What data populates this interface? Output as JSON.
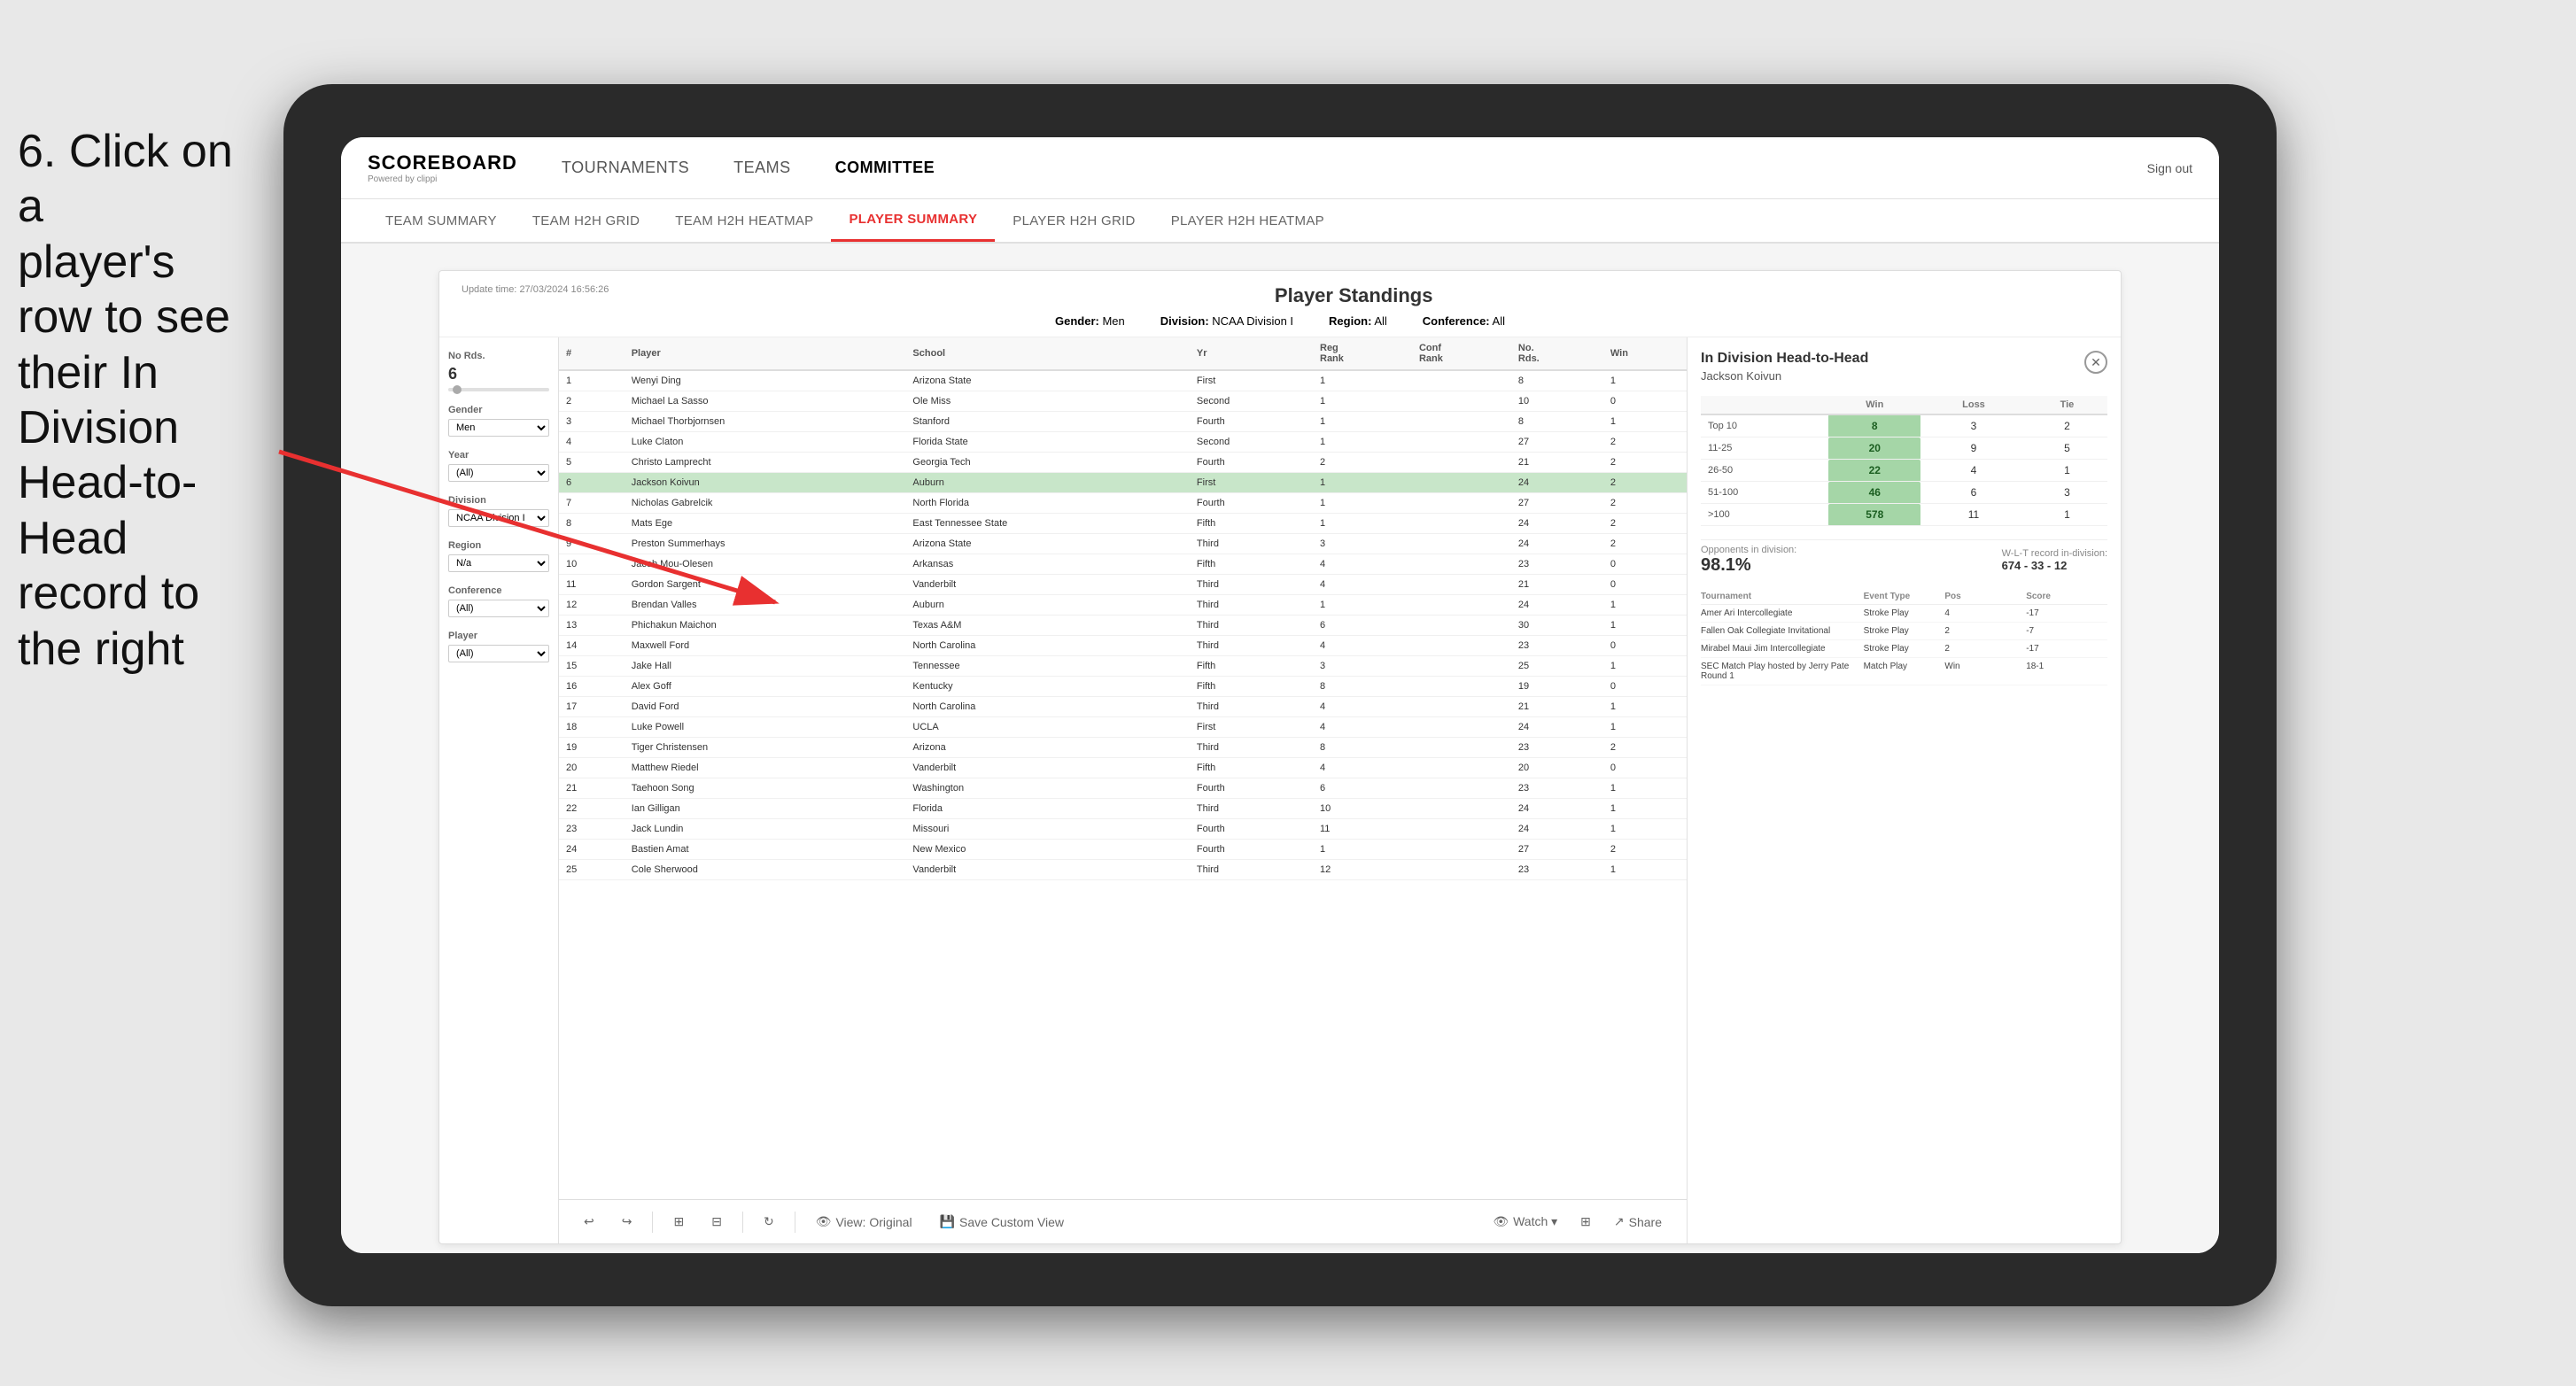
{
  "instruction": {
    "line1": "6. Click on a",
    "line2": "player's row to see",
    "line3": "their In Division",
    "line4": "Head-to-Head",
    "line5": "record to the right"
  },
  "nav": {
    "logo": "SCOREBOARD",
    "logo_sub": "Powered by clippi",
    "items": [
      "TOURNAMENTS",
      "TEAMS",
      "COMMITTEE"
    ],
    "sign_in": "Sign out"
  },
  "sub_nav": {
    "items": [
      "TEAM SUMMARY",
      "TEAM H2H GRID",
      "TEAM H2H HEATMAP",
      "PLAYER SUMMARY",
      "PLAYER H2H GRID",
      "PLAYER H2H HEATMAP"
    ],
    "active": "PLAYER SUMMARY"
  },
  "dashboard": {
    "title": "Player Standings",
    "update_time": "Update time:",
    "update_value": "27/03/2024 16:56:26",
    "filters": {
      "gender_label": "Gender:",
      "gender_value": "Men",
      "division_label": "Division:",
      "division_value": "NCAA Division I",
      "region_label": "Region:",
      "region_value": "All",
      "conference_label": "Conference:",
      "conference_value": "All"
    },
    "sidebar": {
      "no_rds_label": "No Rds.",
      "no_rds_value": "6",
      "gender_label": "Gender",
      "gender_value": "Men",
      "year_label": "Year",
      "year_value": "(All)",
      "division_label": "Division",
      "division_value": "NCAA Division I",
      "region_label": "Region",
      "region_value": "N/a",
      "conference_label": "Conference",
      "conference_value": "(All)",
      "player_label": "Player",
      "player_value": "(All)"
    },
    "table_headers": [
      "#",
      "Player",
      "School",
      "Yr",
      "Reg Rank",
      "Conf Rank",
      "No. Rds.",
      "Win"
    ],
    "players": [
      {
        "rank": 1,
        "name": "Wenyi Ding",
        "school": "Arizona State",
        "yr": "First",
        "reg_rank": 1,
        "conf_rank": "",
        "no_rds": 8,
        "win": 1
      },
      {
        "rank": 2,
        "name": "Michael La Sasso",
        "school": "Ole Miss",
        "yr": "Second",
        "reg_rank": 1,
        "conf_rank": "",
        "no_rds": 10,
        "win": 0
      },
      {
        "rank": 3,
        "name": "Michael Thorbjornsen",
        "school": "Stanford",
        "yr": "Fourth",
        "reg_rank": 1,
        "conf_rank": "",
        "no_rds": 8,
        "win": 1
      },
      {
        "rank": 4,
        "name": "Luke Claton",
        "school": "Florida State",
        "yr": "Second",
        "reg_rank": 1,
        "conf_rank": "",
        "no_rds": 27,
        "win": 2
      },
      {
        "rank": 5,
        "name": "Christo Lamprecht",
        "school": "Georgia Tech",
        "yr": "Fourth",
        "reg_rank": 2,
        "conf_rank": "",
        "no_rds": 21,
        "win": 2
      },
      {
        "rank": 6,
        "name": "Jackson Koivun",
        "school": "Auburn",
        "yr": "First",
        "reg_rank": 1,
        "conf_rank": "",
        "no_rds": 24,
        "win": 2,
        "selected": true
      },
      {
        "rank": 7,
        "name": "Nicholas Gabrelcik",
        "school": "North Florida",
        "yr": "Fourth",
        "reg_rank": 1,
        "conf_rank": "",
        "no_rds": 27,
        "win": 2
      },
      {
        "rank": 8,
        "name": "Mats Ege",
        "school": "East Tennessee State",
        "yr": "Fifth",
        "reg_rank": 1,
        "conf_rank": "",
        "no_rds": 24,
        "win": 2
      },
      {
        "rank": 9,
        "name": "Preston Summerhays",
        "school": "Arizona State",
        "yr": "Third",
        "reg_rank": 3,
        "conf_rank": "",
        "no_rds": 24,
        "win": 2
      },
      {
        "rank": 10,
        "name": "Jacob Mou-Olesen",
        "school": "Arkansas",
        "yr": "Fifth",
        "reg_rank": 4,
        "conf_rank": "",
        "no_rds": 23,
        "win": 0
      },
      {
        "rank": 11,
        "name": "Gordon Sargent",
        "school": "Vanderbilt",
        "yr": "Third",
        "reg_rank": 4,
        "conf_rank": "",
        "no_rds": 21,
        "win": 0
      },
      {
        "rank": 12,
        "name": "Brendan Valles",
        "school": "Auburn",
        "yr": "Third",
        "reg_rank": 1,
        "conf_rank": "",
        "no_rds": 24,
        "win": 1
      },
      {
        "rank": 13,
        "name": "Phichakun Maichon",
        "school": "Texas A&M",
        "yr": "Third",
        "reg_rank": 6,
        "conf_rank": "",
        "no_rds": 30,
        "win": 1
      },
      {
        "rank": 14,
        "name": "Maxwell Ford",
        "school": "North Carolina",
        "yr": "Third",
        "reg_rank": 4,
        "conf_rank": "",
        "no_rds": 23,
        "win": 0
      },
      {
        "rank": 15,
        "name": "Jake Hall",
        "school": "Tennessee",
        "yr": "Fifth",
        "reg_rank": 3,
        "conf_rank": "",
        "no_rds": 25,
        "win": 1
      },
      {
        "rank": 16,
        "name": "Alex Goff",
        "school": "Kentucky",
        "yr": "Fifth",
        "reg_rank": 8,
        "conf_rank": "",
        "no_rds": 19,
        "win": 0
      },
      {
        "rank": 17,
        "name": "David Ford",
        "school": "North Carolina",
        "yr": "Third",
        "reg_rank": 4,
        "conf_rank": "",
        "no_rds": 21,
        "win": 1
      },
      {
        "rank": 18,
        "name": "Luke Powell",
        "school": "UCLA",
        "yr": "First",
        "reg_rank": 4,
        "conf_rank": "",
        "no_rds": 24,
        "win": 1
      },
      {
        "rank": 19,
        "name": "Tiger Christensen",
        "school": "Arizona",
        "yr": "Third",
        "reg_rank": 8,
        "conf_rank": "",
        "no_rds": 23,
        "win": 2
      },
      {
        "rank": 20,
        "name": "Matthew Riedel",
        "school": "Vanderbilt",
        "yr": "Fifth",
        "reg_rank": 4,
        "conf_rank": "",
        "no_rds": 20,
        "win": 0
      },
      {
        "rank": 21,
        "name": "Taehoon Song",
        "school": "Washington",
        "yr": "Fourth",
        "reg_rank": 6,
        "conf_rank": "",
        "no_rds": 23,
        "win": 1
      },
      {
        "rank": 22,
        "name": "Ian Gilligan",
        "school": "Florida",
        "yr": "Third",
        "reg_rank": 10,
        "conf_rank": "",
        "no_rds": 24,
        "win": 1
      },
      {
        "rank": 23,
        "name": "Jack Lundin",
        "school": "Missouri",
        "yr": "Fourth",
        "reg_rank": 11,
        "conf_rank": "",
        "no_rds": 24,
        "win": 1
      },
      {
        "rank": 24,
        "name": "Bastien Amat",
        "school": "New Mexico",
        "yr": "Fourth",
        "reg_rank": 1,
        "conf_rank": "",
        "no_rds": 27,
        "win": 2
      },
      {
        "rank": 25,
        "name": "Cole Sherwood",
        "school": "Vanderbilt",
        "yr": "Third",
        "reg_rank": 12,
        "conf_rank": "",
        "no_rds": 23,
        "win": 1
      }
    ],
    "h2h": {
      "title": "In Division Head-to-Head",
      "player": "Jackson Koivun",
      "columns": [
        "Win",
        "Loss",
        "Tie"
      ],
      "rows": [
        {
          "label": "Top 10",
          "win": 8,
          "loss": 3,
          "tie": 2
        },
        {
          "label": "11-25",
          "win": 20,
          "loss": 9,
          "tie": 5
        },
        {
          "label": "26-50",
          "win": 22,
          "loss": 4,
          "tie": 1
        },
        {
          "label": "51-100",
          "win": 46,
          "loss": 6,
          "tie": 3
        },
        {
          "label": ">100",
          "win": 578,
          "loss": 11,
          "tie": 1
        }
      ],
      "opponents_label": "Opponents in division:",
      "opponents_value": "98.1%",
      "record_label": "W-L-T record in-division:",
      "record_value": "674 - 33 - 12",
      "tournaments": [
        {
          "name": "Amer Ari Intercollegiate",
          "type": "Stroke Play",
          "pos": 4,
          "score": "-17"
        },
        {
          "name": "Fallen Oak Collegiate Invitational",
          "type": "Stroke Play",
          "pos": 2,
          "score": "-7"
        },
        {
          "name": "Mirabel Maui Jim Intercollegiate",
          "type": "Stroke Play",
          "pos": 2,
          "score": "-17"
        },
        {
          "name": "SEC Match Play hosted by Jerry Pate Round 1",
          "type": "Match Play",
          "pos": "Win",
          "score": "18-1"
        }
      ]
    },
    "toolbar": {
      "view_original": "View: Original",
      "save_custom": "Save Custom View",
      "watch": "Watch ▾",
      "share": "Share"
    }
  }
}
